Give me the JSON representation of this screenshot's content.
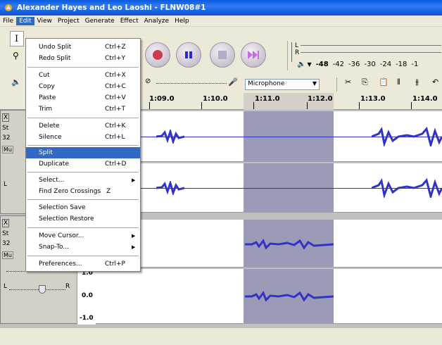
{
  "window": {
    "title": "Alexander Hayes and Leo Laoshi - FLNW08#1"
  },
  "menubar": [
    "File",
    "Edit",
    "View",
    "Project",
    "Generate",
    "Effect",
    "Analyze",
    "Help"
  ],
  "edit_menu": [
    {
      "label": "Undo Split",
      "shortcut": "Ctrl+Z"
    },
    {
      "label": "Redo Split",
      "shortcut": "Ctrl+Y"
    },
    {
      "label": "Cut",
      "shortcut": "Ctrl+X"
    },
    {
      "label": "Copy",
      "shortcut": "Ctrl+C"
    },
    {
      "label": "Paste",
      "shortcut": "Ctrl+V"
    },
    {
      "label": "Trim",
      "shortcut": "Ctrl+T"
    },
    {
      "label": "Delete",
      "shortcut": "Ctrl+K"
    },
    {
      "label": "Silence",
      "shortcut": "Ctrl+L"
    },
    {
      "label": "Split",
      "shortcut": ""
    },
    {
      "label": "Duplicate",
      "shortcut": "Ctrl+D"
    },
    {
      "label": "Select...",
      "shortcut": "",
      "submenu": true
    },
    {
      "label": "Find Zero Crossings",
      "shortcut": "Z"
    },
    {
      "label": "Selection Save",
      "shortcut": ""
    },
    {
      "label": "Selection Restore",
      "shortcut": ""
    },
    {
      "label": "Move Cursor...",
      "shortcut": "",
      "submenu": true
    },
    {
      "label": "Snap-To...",
      "shortcut": "",
      "submenu": true
    },
    {
      "label": "Preferences...",
      "shortcut": "Ctrl+P"
    }
  ],
  "meter": {
    "ticks": [
      "-48",
      "-42",
      "-36",
      "-30",
      "-24",
      "-18",
      "-1"
    ],
    "L": "L",
    "R": "R"
  },
  "input_source": "Microphone",
  "ruler": [
    "1:09.0",
    "1:10.0",
    "1:11.0",
    "1:12.0",
    "1:13.0",
    "1:14.0"
  ],
  "track_labels": {
    "close": "X",
    "stereo": "St",
    "rate": "32",
    "mute": "Mu",
    "l": "L",
    "r": "R"
  },
  "scale": [
    "1.0",
    "0.0",
    "-1.0"
  ],
  "colors": {
    "accent": "#316AC5",
    "selection": "#9B9BB8",
    "wave": "#3232C8"
  }
}
